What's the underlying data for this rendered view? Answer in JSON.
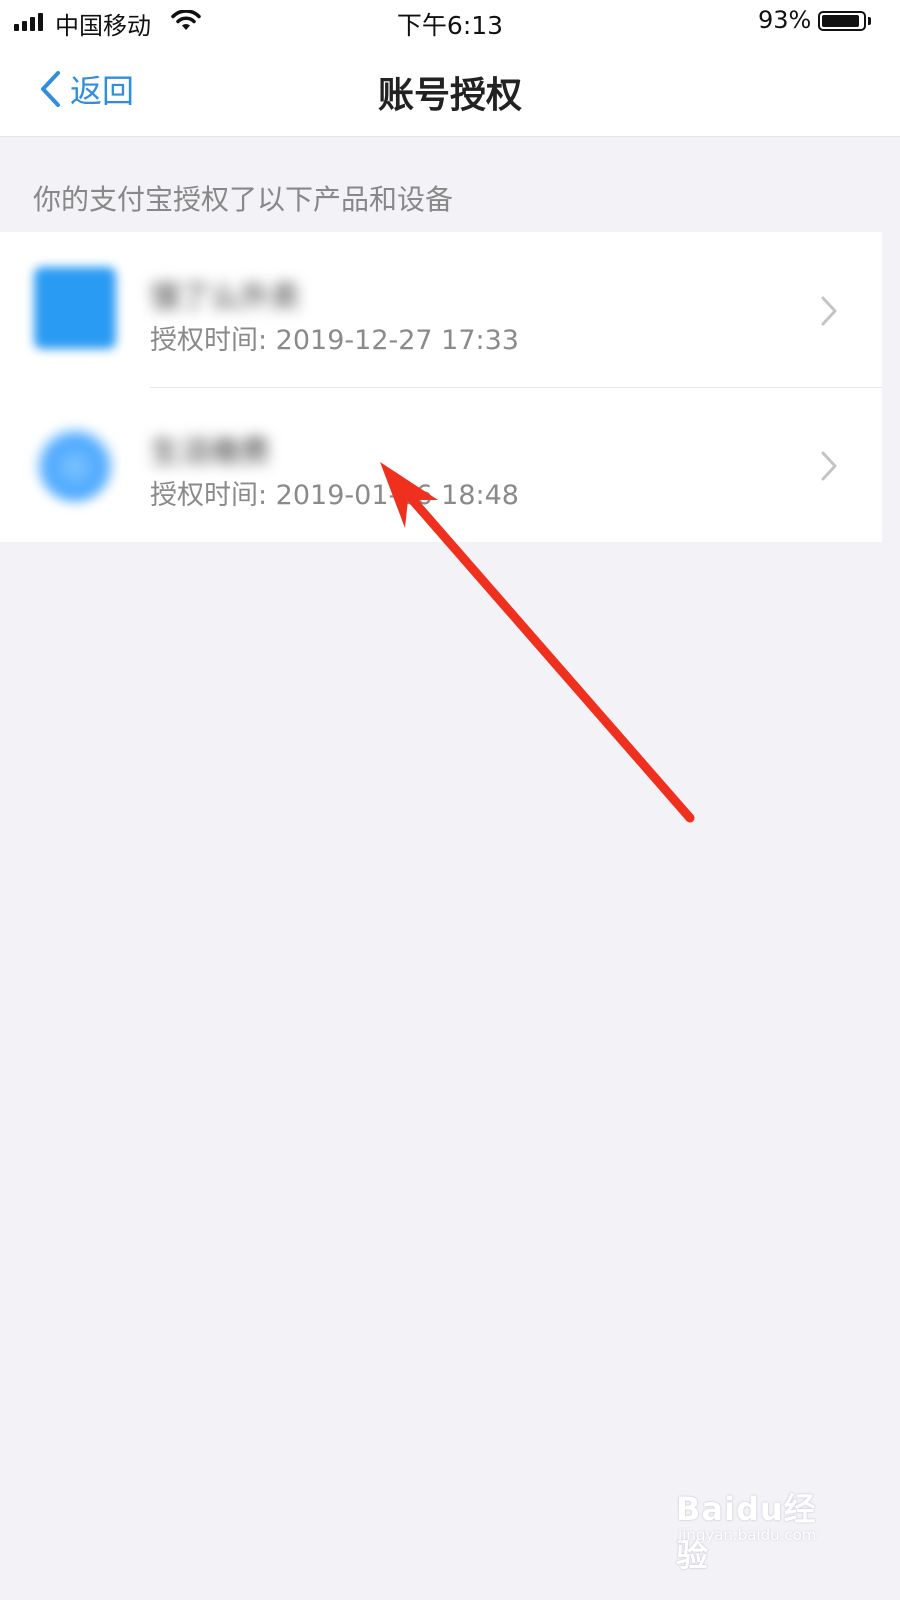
{
  "status_bar": {
    "carrier": "中国移动",
    "time": "下午6:13",
    "battery_percent": "93%",
    "battery_level": 0.93
  },
  "nav": {
    "back_label": "返回",
    "title": "账号授权"
  },
  "section_header": "你的支付宝授权了以下产品和设备",
  "items": [
    {
      "name": "饿了么外卖",
      "time_label": "授权时间: 2019-12-27 17:33"
    },
    {
      "name": "生活缴费",
      "time_label": "授权时间: 2019-01-26 18:48"
    }
  ],
  "watermark": {
    "main": "Baidu经验",
    "sub": "jingyan.baidu.com"
  },
  "colors": {
    "accent": "#2f8ee0",
    "background": "#f3f2f7",
    "annotation": "#f0301e"
  }
}
